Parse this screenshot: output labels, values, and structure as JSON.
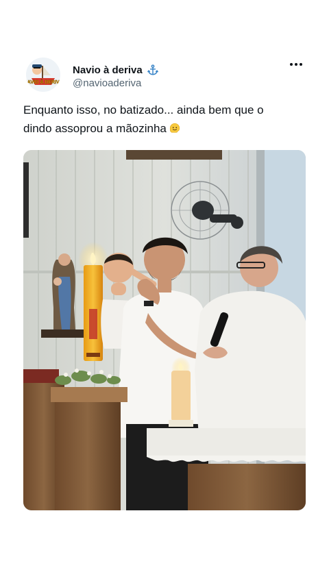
{
  "tweet": {
    "author": {
      "name": "Navio à deriva",
      "handle": "@navioaderiva",
      "avatar_text": "NAVIO À DERIVA",
      "badge_icon": "anchor-icon"
    },
    "more_icon": "more-horizontal-icon",
    "text_line1": "Enquanto isso, no batizado... ainda bem que o",
    "text_line2": "dindo assoprou a mãozinha",
    "emoji": "melting-face-emoji",
    "media": {
      "type": "photo",
      "description_icon": "baptism-photo"
    }
  },
  "colors": {
    "name": "#0f1419",
    "handle": "#536471",
    "background": "#ffffff",
    "anchor": "#3b86c8"
  }
}
